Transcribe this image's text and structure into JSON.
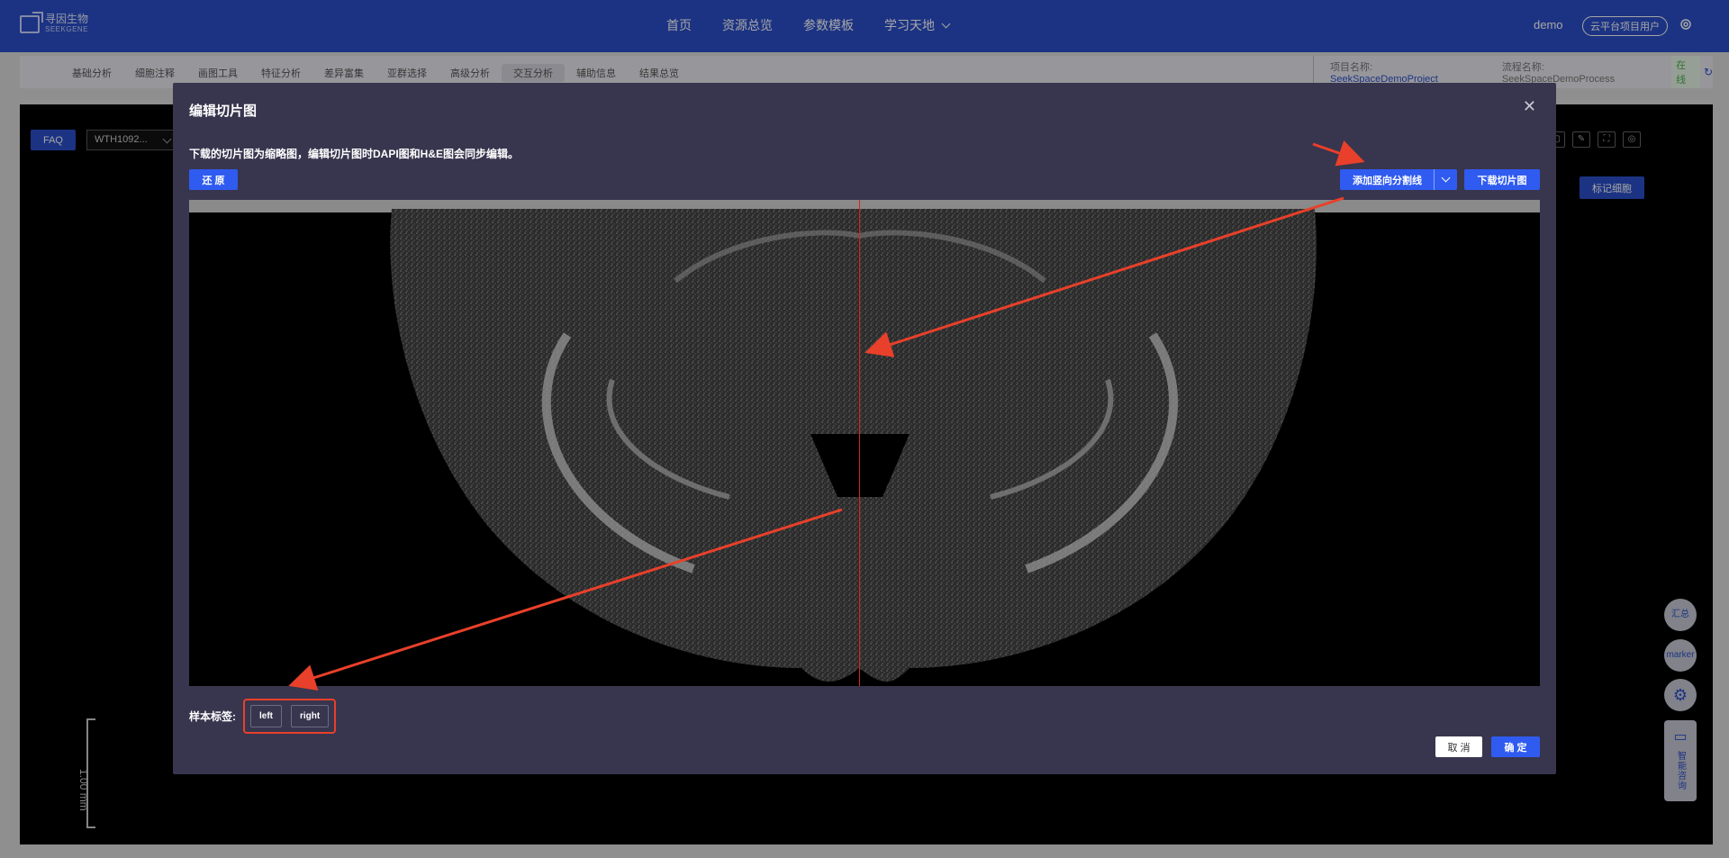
{
  "nav": {
    "logo_cn": "寻因生物",
    "logo_en": "SEEKGENE",
    "items": [
      {
        "label": "首页"
      },
      {
        "label": "资源总览"
      },
      {
        "label": "参数模板"
      },
      {
        "label": "学习天地"
      }
    ],
    "user": "demo",
    "badge": "云平台项目用户"
  },
  "subnav": {
    "tabs": [
      {
        "label": "基础分析"
      },
      {
        "label": "细胞注释"
      },
      {
        "label": "画图工具"
      },
      {
        "label": "特征分析"
      },
      {
        "label": "差异富集"
      },
      {
        "label": "亚群选择"
      },
      {
        "label": "高级分析"
      },
      {
        "label": "交互分析"
      },
      {
        "label": "辅助信息"
      },
      {
        "label": "结果总览"
      }
    ],
    "project_label": "项目名称:",
    "project_value": "SeekSpaceDemoProject",
    "process_label": "流程名称:",
    "process_value": "SeekSpaceDemoProcess",
    "status": "在线"
  },
  "background": {
    "faq": "FAQ",
    "sample": "WTH1092...",
    "mark_cell": "标记细胞",
    "scale": "1.00 mm",
    "float": {
      "summary": "汇总",
      "marker": "marker",
      "chat": "智能咨询"
    }
  },
  "modal": {
    "title": "编辑切片图",
    "description": "下载的切片图为缩略图，编辑切片图时DAPI图和H&E图会同步编辑。",
    "restore": "还 原",
    "add_split": "添加竖向分割线",
    "download": "下载切片图",
    "label_title": "样本标签:",
    "tags": [
      {
        "label": "left"
      },
      {
        "label": "right"
      }
    ],
    "cancel": "取 消",
    "ok": "确 定"
  },
  "colors": {
    "primary": "#2c4fc9",
    "button": "#2f5bf0",
    "annotation": "#e8402a",
    "split_line": "#e02020"
  }
}
